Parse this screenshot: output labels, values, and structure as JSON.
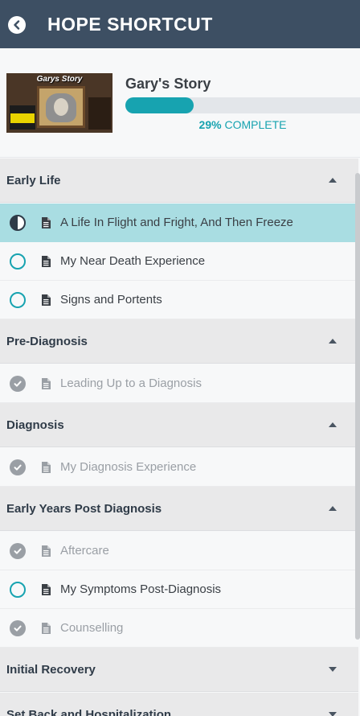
{
  "header": {
    "title": "HOPE SHORTCUT"
  },
  "course": {
    "title": "Gary's Story",
    "thumbnail_caption": "Garys Story",
    "progress": 0.29,
    "progress_percent": "29%",
    "progress_suffix": "COMPLETE"
  },
  "colors": {
    "header": "#3d4f63",
    "accent": "#17a3b0",
    "active_row": "#a9dde2",
    "done": "#9a9fa5"
  },
  "sections": [
    {
      "title": "Early Life",
      "expanded": true,
      "caret_icon": "caret-up-icon",
      "items": [
        {
          "label": "A Life In Flight and Fright, And Then Freeze",
          "status": "in-progress",
          "active": true
        },
        {
          "label": "My Near Death Experience",
          "status": "not-started"
        },
        {
          "label": "Signs and Portents",
          "status": "not-started"
        }
      ]
    },
    {
      "title": "Pre-Diagnosis",
      "expanded": true,
      "caret_icon": "caret-up-icon",
      "items": [
        {
          "label": "Leading Up to a Diagnosis",
          "status": "completed"
        }
      ]
    },
    {
      "title": "Diagnosis",
      "expanded": true,
      "caret_icon": "caret-up-icon",
      "items": [
        {
          "label": "My Diagnosis Experience",
          "status": "completed"
        }
      ]
    },
    {
      "title": "Early Years Post Diagnosis",
      "expanded": true,
      "caret_icon": "caret-up-icon",
      "items": [
        {
          "label": "Aftercare",
          "status": "completed"
        },
        {
          "label": "My Symptoms Post-Diagnosis",
          "status": "not-started"
        },
        {
          "label": "Counselling",
          "status": "completed"
        }
      ]
    },
    {
      "title": "Initial Recovery",
      "expanded": false,
      "caret_icon": "caret-down-icon",
      "items": []
    },
    {
      "title": "Set Back and Hospitalization",
      "expanded": false,
      "caret_icon": "caret-down-icon",
      "items": []
    }
  ]
}
